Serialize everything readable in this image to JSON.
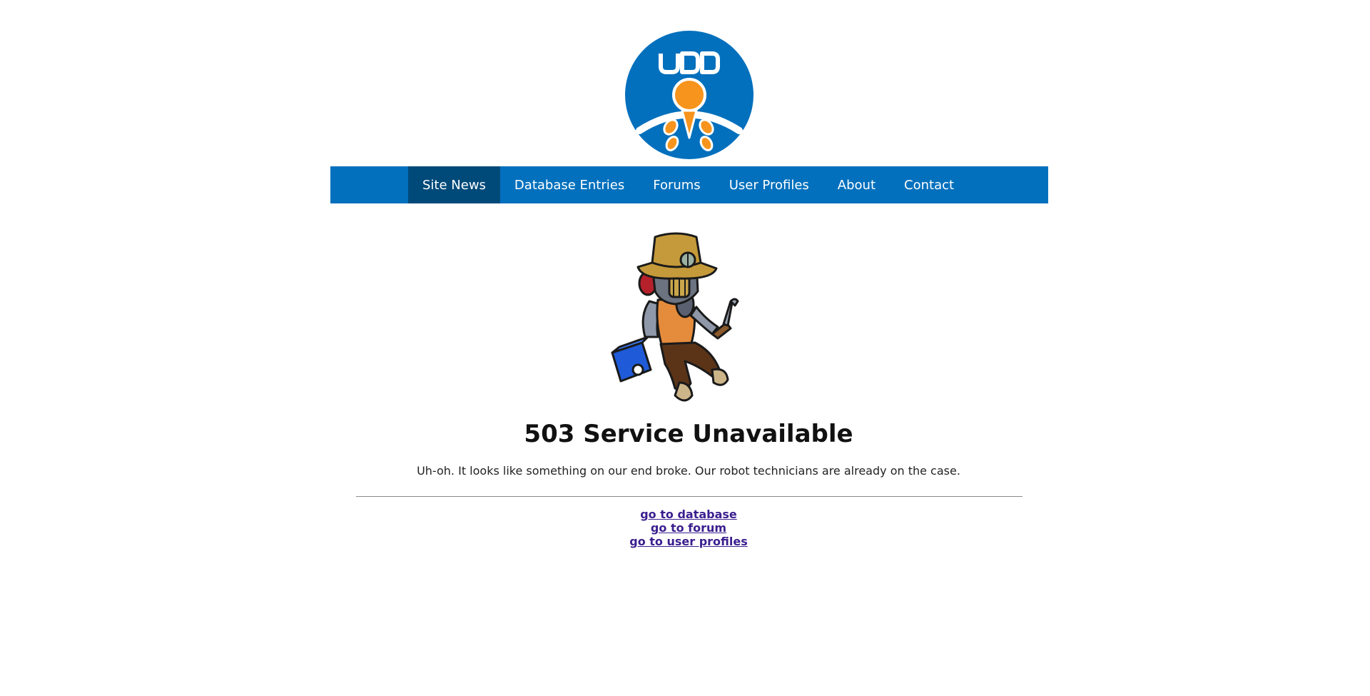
{
  "header": {
    "logo_text": "UDD",
    "logo_colors": {
      "circle": "#0370bd",
      "accent": "#f7941d",
      "white": "#ffffff"
    }
  },
  "nav": {
    "background": "#0370bd",
    "active_background": "#004a7a",
    "items": [
      {
        "label": "Site News",
        "active": true
      },
      {
        "label": "Database Entries",
        "active": false
      },
      {
        "label": "Forums",
        "active": false
      },
      {
        "label": "User Profiles",
        "active": false
      },
      {
        "label": "About",
        "active": false
      },
      {
        "label": "Contact",
        "active": false
      }
    ]
  },
  "main": {
    "illustration": "robot-technician-illustration",
    "title": "503 Service Unavailable",
    "message": "Uh-oh. It looks like something on our end broke. Our robot technicians are already on the case.",
    "links": [
      {
        "label": "go to database"
      },
      {
        "label": "go to forum"
      },
      {
        "label": "go to user profiles"
      }
    ],
    "link_color": "#3b1f8f"
  }
}
